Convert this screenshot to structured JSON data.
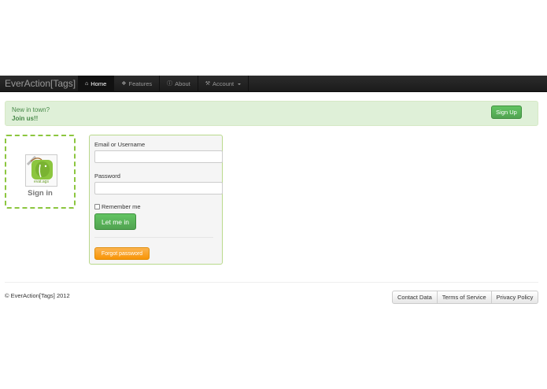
{
  "navbar": {
    "brand": "EverAction[Tags]",
    "items": [
      {
        "label": "Home",
        "icon": "home-icon",
        "active": true
      },
      {
        "label": "Features",
        "icon": "tags-icon"
      },
      {
        "label": "About",
        "icon": "info-icon"
      },
      {
        "label": "Account",
        "icon": "wrench-icon",
        "dropdown": true
      }
    ]
  },
  "alert": {
    "line1": "New in town?",
    "line2": "Join us!!",
    "button": "Sign Up"
  },
  "sidebar": {
    "logo_text": "evat.ags",
    "title": "Sign in"
  },
  "login": {
    "email_label": "Email or Username",
    "email_value": "",
    "password_label": "Password",
    "password_value": "",
    "remember_label": "Remember me",
    "remember_checked": false,
    "submit": "Let me in",
    "forgot": "Forgot password"
  },
  "footer": {
    "copyright": "© EverAction[Tags] 2012",
    "links": [
      "Contact Data",
      "Terms of Service",
      "Privacy Policy"
    ]
  },
  "colors": {
    "navbar": "#1b1b1b",
    "alert_bg": "#dff0d8",
    "alert_text": "#468847",
    "success": "#51a351",
    "warning": "#f89406",
    "accent_border": "#8cc63f"
  }
}
